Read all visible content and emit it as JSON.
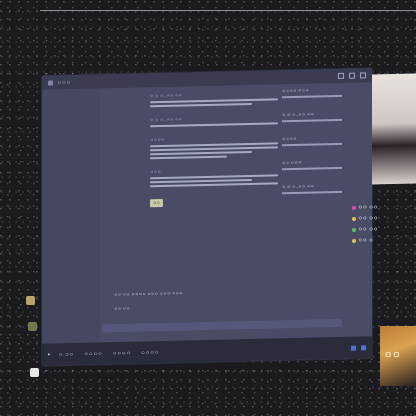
{
  "window": {
    "title": "ㅇㅇㅇ"
  },
  "chat": {
    "messages": [
      {
        "who": "ㅇ.ㅇ ㅇ..ㅇㅇ ㅇㅇ"
      },
      {
        "who": "ㅇ.ㅇ ㅇ..ㅇㅇ ㅇㅇ"
      },
      {
        "who": "ㅇㅇㅇㅇ"
      },
      {
        "who": "ㅇㅇㅇ"
      }
    ],
    "chip_label": "ㅇㅇ",
    "note1": "ㅇㅇ ㅇㅇ ㅇ ㅇㅇㅇ",
    "note2": "ㅇㅇ ㅇㅇ ㅇㅇㅇㅇ ㅇㅇㅇ ㅇㅇㅇ ㅇㅇㅇ",
    "note3": "ㅇㅇ ㅇㅇ"
  },
  "side": {
    "entries": [
      {
        "name": "ㅇㅇㅇㅇ ㅇㅇㅇ"
      },
      {
        "name": "ㅇ.ㅇ ㅇ..ㅇㅇ ㅇㅇ"
      },
      {
        "name": "ㅇㅇㅇㅇ"
      },
      {
        "name": "ㅇㅇ ㅇㅇㅇ"
      },
      {
        "name": "ㅇ.ㅇ ㅇ..ㅇㅇ ㅇㅇ"
      }
    ]
  },
  "taskbar": {
    "items": [
      "ㅇ.ㅇㅇ",
      "ㅇㅇㅇㅇ",
      "ㅇㅇㅇㅇ",
      "ㅇㅇㅇㅇ"
    ]
  },
  "badges": [
    {
      "label": "ㅇㅇ ㅇㅇ",
      "color": "#e04fb0"
    },
    {
      "label": "ㅇㅇ ㅇㅇ",
      "color": "#e0c34f"
    },
    {
      "label": "ㅇㅇ ㅇㅇ",
      "color": "#59c35a"
    },
    {
      "label": "ㅇㅇ ㅇ",
      "color": "#e0c34f"
    }
  ],
  "photo_text": "ㅇㅇ",
  "colors": {
    "accent": "#4e73c8"
  }
}
